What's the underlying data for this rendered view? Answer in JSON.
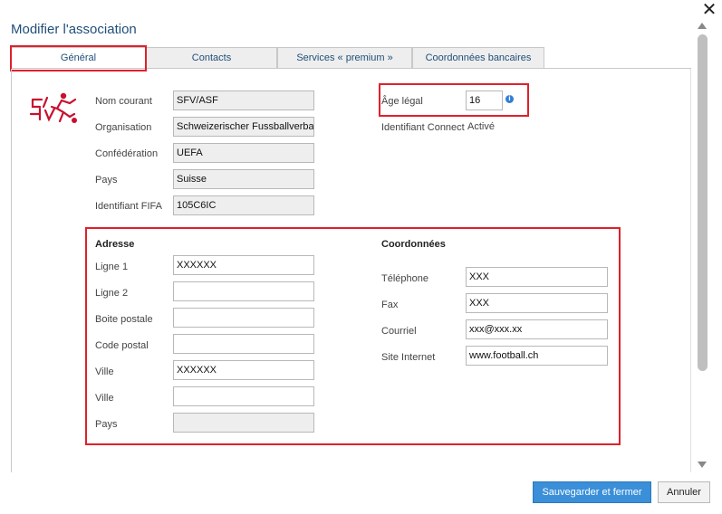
{
  "dialog": {
    "title": "Modifier l'association",
    "close_symbol": "✕"
  },
  "tabs": [
    {
      "label": "Général",
      "active": true
    },
    {
      "label": "Contacts",
      "active": false
    },
    {
      "label": "Services « premium »",
      "active": false
    },
    {
      "label": "Coordonnées bancaires",
      "active": false
    }
  ],
  "general": {
    "logo_icon": "sfv-asf-logo-icon",
    "fields": {
      "nom_courant": {
        "label": "Nom courant",
        "value": "SFV/ASF"
      },
      "organisation": {
        "label": "Organisation",
        "value": "Schweizerischer Fussballverbar"
      },
      "confederation": {
        "label": "Confédération",
        "value": "UEFA"
      },
      "pays": {
        "label": "Pays",
        "value": "Suisse"
      },
      "identifiant_fifa": {
        "label": "Identifiant FIFA",
        "value": "105C6IC"
      }
    },
    "age_legal": {
      "label": "Âge légal",
      "value": "16",
      "info_symbol": "i"
    },
    "identifiant_connect": {
      "label": "Identifiant Connect",
      "value": "Activé"
    }
  },
  "adresse": {
    "title": "Adresse",
    "fields": [
      {
        "label": "Ligne 1",
        "value": "XXXXXX",
        "readonly": false
      },
      {
        "label": "Ligne 2",
        "value": "",
        "readonly": false
      },
      {
        "label": "Boite postale",
        "value": "",
        "readonly": false
      },
      {
        "label": "Code postal",
        "value": "",
        "readonly": false
      },
      {
        "label": "Ville",
        "value": "XXXXXX",
        "readonly": false
      },
      {
        "label": "Ville",
        "value": "",
        "readonly": false
      },
      {
        "label": "Pays",
        "value": "",
        "readonly": true
      }
    ]
  },
  "coordonnees": {
    "title": "Coordonnées",
    "fields": [
      {
        "label": "Téléphone",
        "value": "XXX"
      },
      {
        "label": "Fax",
        "value": "XXX"
      },
      {
        "label": "Courriel",
        "value": "xxx@xxx.xx"
      },
      {
        "label": "Site Internet",
        "value": "www.football.ch"
      }
    ]
  },
  "buttons": {
    "save": "Sauvegarder et fermer",
    "cancel": "Annuler"
  },
  "colors": {
    "accent": "#3a8fd8",
    "title": "#1f4e79",
    "highlight_box": "#e0202a",
    "logo": "#c8102e"
  }
}
